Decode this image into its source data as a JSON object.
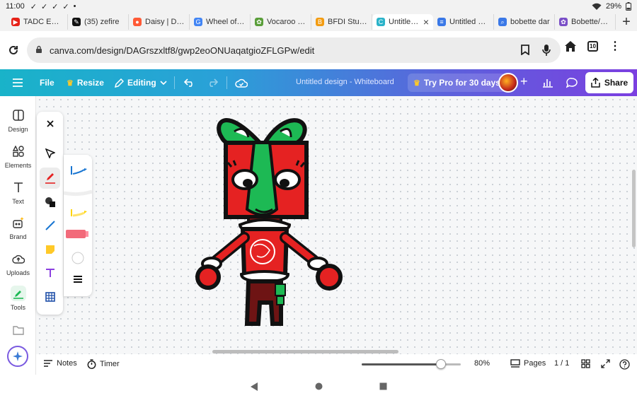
{
  "status_bar": {
    "time": "11:00",
    "battery": "29%"
  },
  "tabs": [
    {
      "title": "TADC Episo",
      "color": "#e62117",
      "glyph": "▶"
    },
    {
      "title": "(35) zefire",
      "color": "#111111",
      "glyph": "✎"
    },
    {
      "title": "Daisy | Dais",
      "color": "#ff5a36",
      "glyph": "●"
    },
    {
      "title": "Wheel of Na",
      "color": "#4285f4",
      "glyph": "G"
    },
    {
      "title": "Vocaroo | O",
      "color": "#5a9e3a",
      "glyph": "✿"
    },
    {
      "title": "BFDI Studio",
      "color": "#f39c12",
      "glyph": "B"
    },
    {
      "title": "Untitled d",
      "color": "#2bb3c9",
      "glyph": "C",
      "active": true
    },
    {
      "title": "Untitled doc",
      "color": "#3a78e7",
      "glyph": "≡"
    },
    {
      "title": "bobette dar",
      "color": "#3a78e7",
      "glyph": "⌕"
    },
    {
      "title": "Bobette/Gal",
      "color": "#7a4fc7",
      "glyph": "✿"
    }
  ],
  "address_bar": {
    "url": "canva.com/design/DAGrszxltf8/gwp2eoONUaqatgioZFLGPw/edit",
    "tab_count": "10"
  },
  "canva_header": {
    "file_label": "File",
    "resize_label": "Resize",
    "editing_label": "Editing",
    "design_title": "Untitled design - Whiteboard",
    "pro_label": "Try Pro for 30 days",
    "share_label": "Share"
  },
  "rail_items": [
    {
      "label": "Design"
    },
    {
      "label": "Elements"
    },
    {
      "label": "Text"
    },
    {
      "label": "Brand"
    },
    {
      "label": "Uploads"
    },
    {
      "label": "Tools"
    }
  ],
  "bottom_bar": {
    "notes_label": "Notes",
    "timer_label": "Timer",
    "zoom": "80%",
    "zoom_fraction": 0.8,
    "pages_label": "Pages",
    "page_count": "1 / 1"
  },
  "colors": {
    "header_start": "#19b3c9",
    "header_end": "#7b3fe0",
    "drawing_red": "#e52222",
    "drawing_green": "#1db954",
    "drawing_maroon": "#6e1414"
  }
}
